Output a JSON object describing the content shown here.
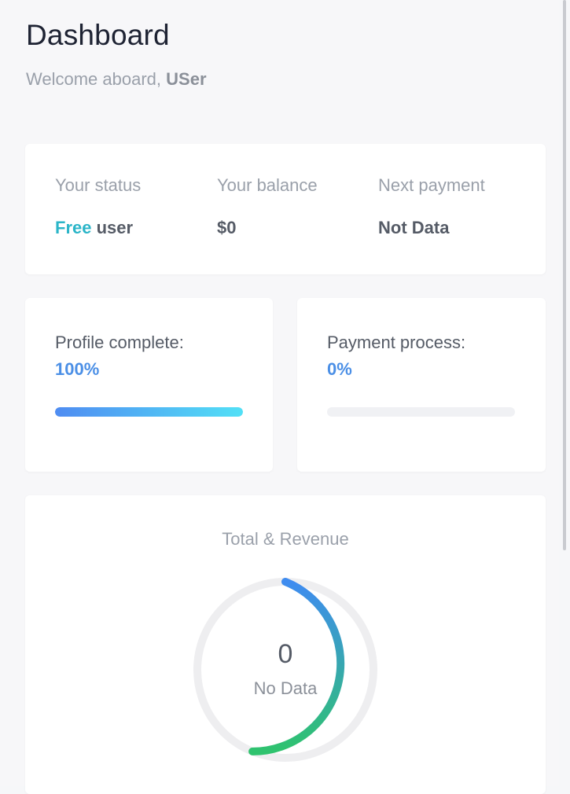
{
  "header": {
    "title": "Dashboard",
    "welcome_prefix": "Welcome aboard, ",
    "user_name": "USer"
  },
  "status": {
    "status_label": "Your status",
    "status_accent": "Free",
    "status_suffix": " user",
    "balance_label": "Your balance",
    "balance_value": "$0",
    "next_payment_label": "Next payment",
    "next_payment_value": "Not Data"
  },
  "progress": [
    {
      "label": "Profile complete:",
      "value_text": "100%",
      "value": 100
    },
    {
      "label": "Payment process:",
      "value_text": "0%",
      "value": 0
    }
  ],
  "revenue": {
    "title": "Total & Revenue",
    "value": "0",
    "caption": "No Data"
  },
  "colors": {
    "accent_teal": "#2bb5c8",
    "accent_blue": "#4b8fe6",
    "progress_start": "#4f8cf2",
    "progress_end": "#52e0f6",
    "ring_start": "#3f8cf0",
    "ring_end": "#2fc36e",
    "ring_track": "#eeeef0"
  }
}
